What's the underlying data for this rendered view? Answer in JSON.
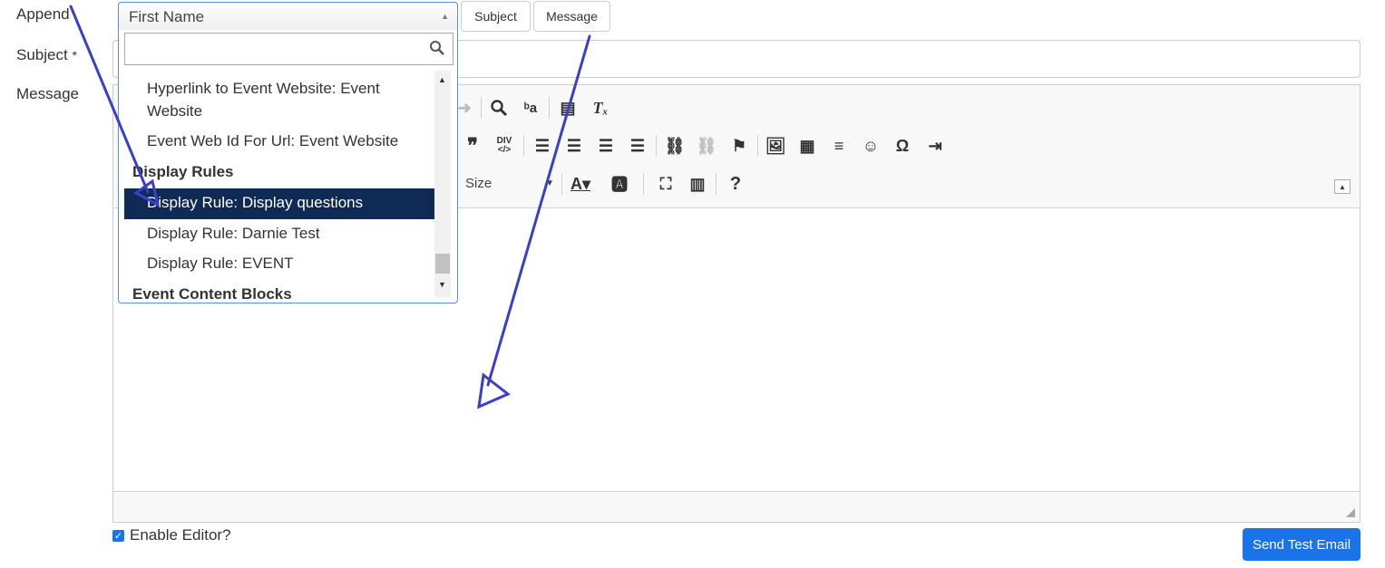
{
  "labels": {
    "append": "Append",
    "subject": "Subject",
    "required_mark": "*",
    "message": "Message"
  },
  "buttons": {
    "subject": "Subject",
    "message": "Message",
    "send_test_email": "Send Test Email"
  },
  "select": {
    "selected_value": "First Name",
    "search_placeholder": "",
    "items": [
      {
        "label": "Hyperlink to Event Website: Event",
        "type": "option"
      },
      {
        "label": "Website",
        "type": "option-cont"
      },
      {
        "label": "Event Web Id For Url: Event Website",
        "type": "option"
      },
      {
        "label": "Display Rules",
        "type": "group"
      },
      {
        "label": "Display Rule: Display questions",
        "type": "option",
        "selected": true
      },
      {
        "label": "Display Rule: Darnie Test",
        "type": "option"
      },
      {
        "label": "Display Rule: EVENT",
        "type": "option"
      },
      {
        "label": "Event Content Blocks",
        "type": "group"
      }
    ]
  },
  "editor": {
    "size_label": "Size",
    "enable_editor_label": "Enable Editor?",
    "enable_editor_checked": true
  },
  "colors": {
    "accent": "#1a73e8",
    "selected_option_bg": "#0e2a55",
    "annotation_arrow": "#3b3fc7"
  }
}
